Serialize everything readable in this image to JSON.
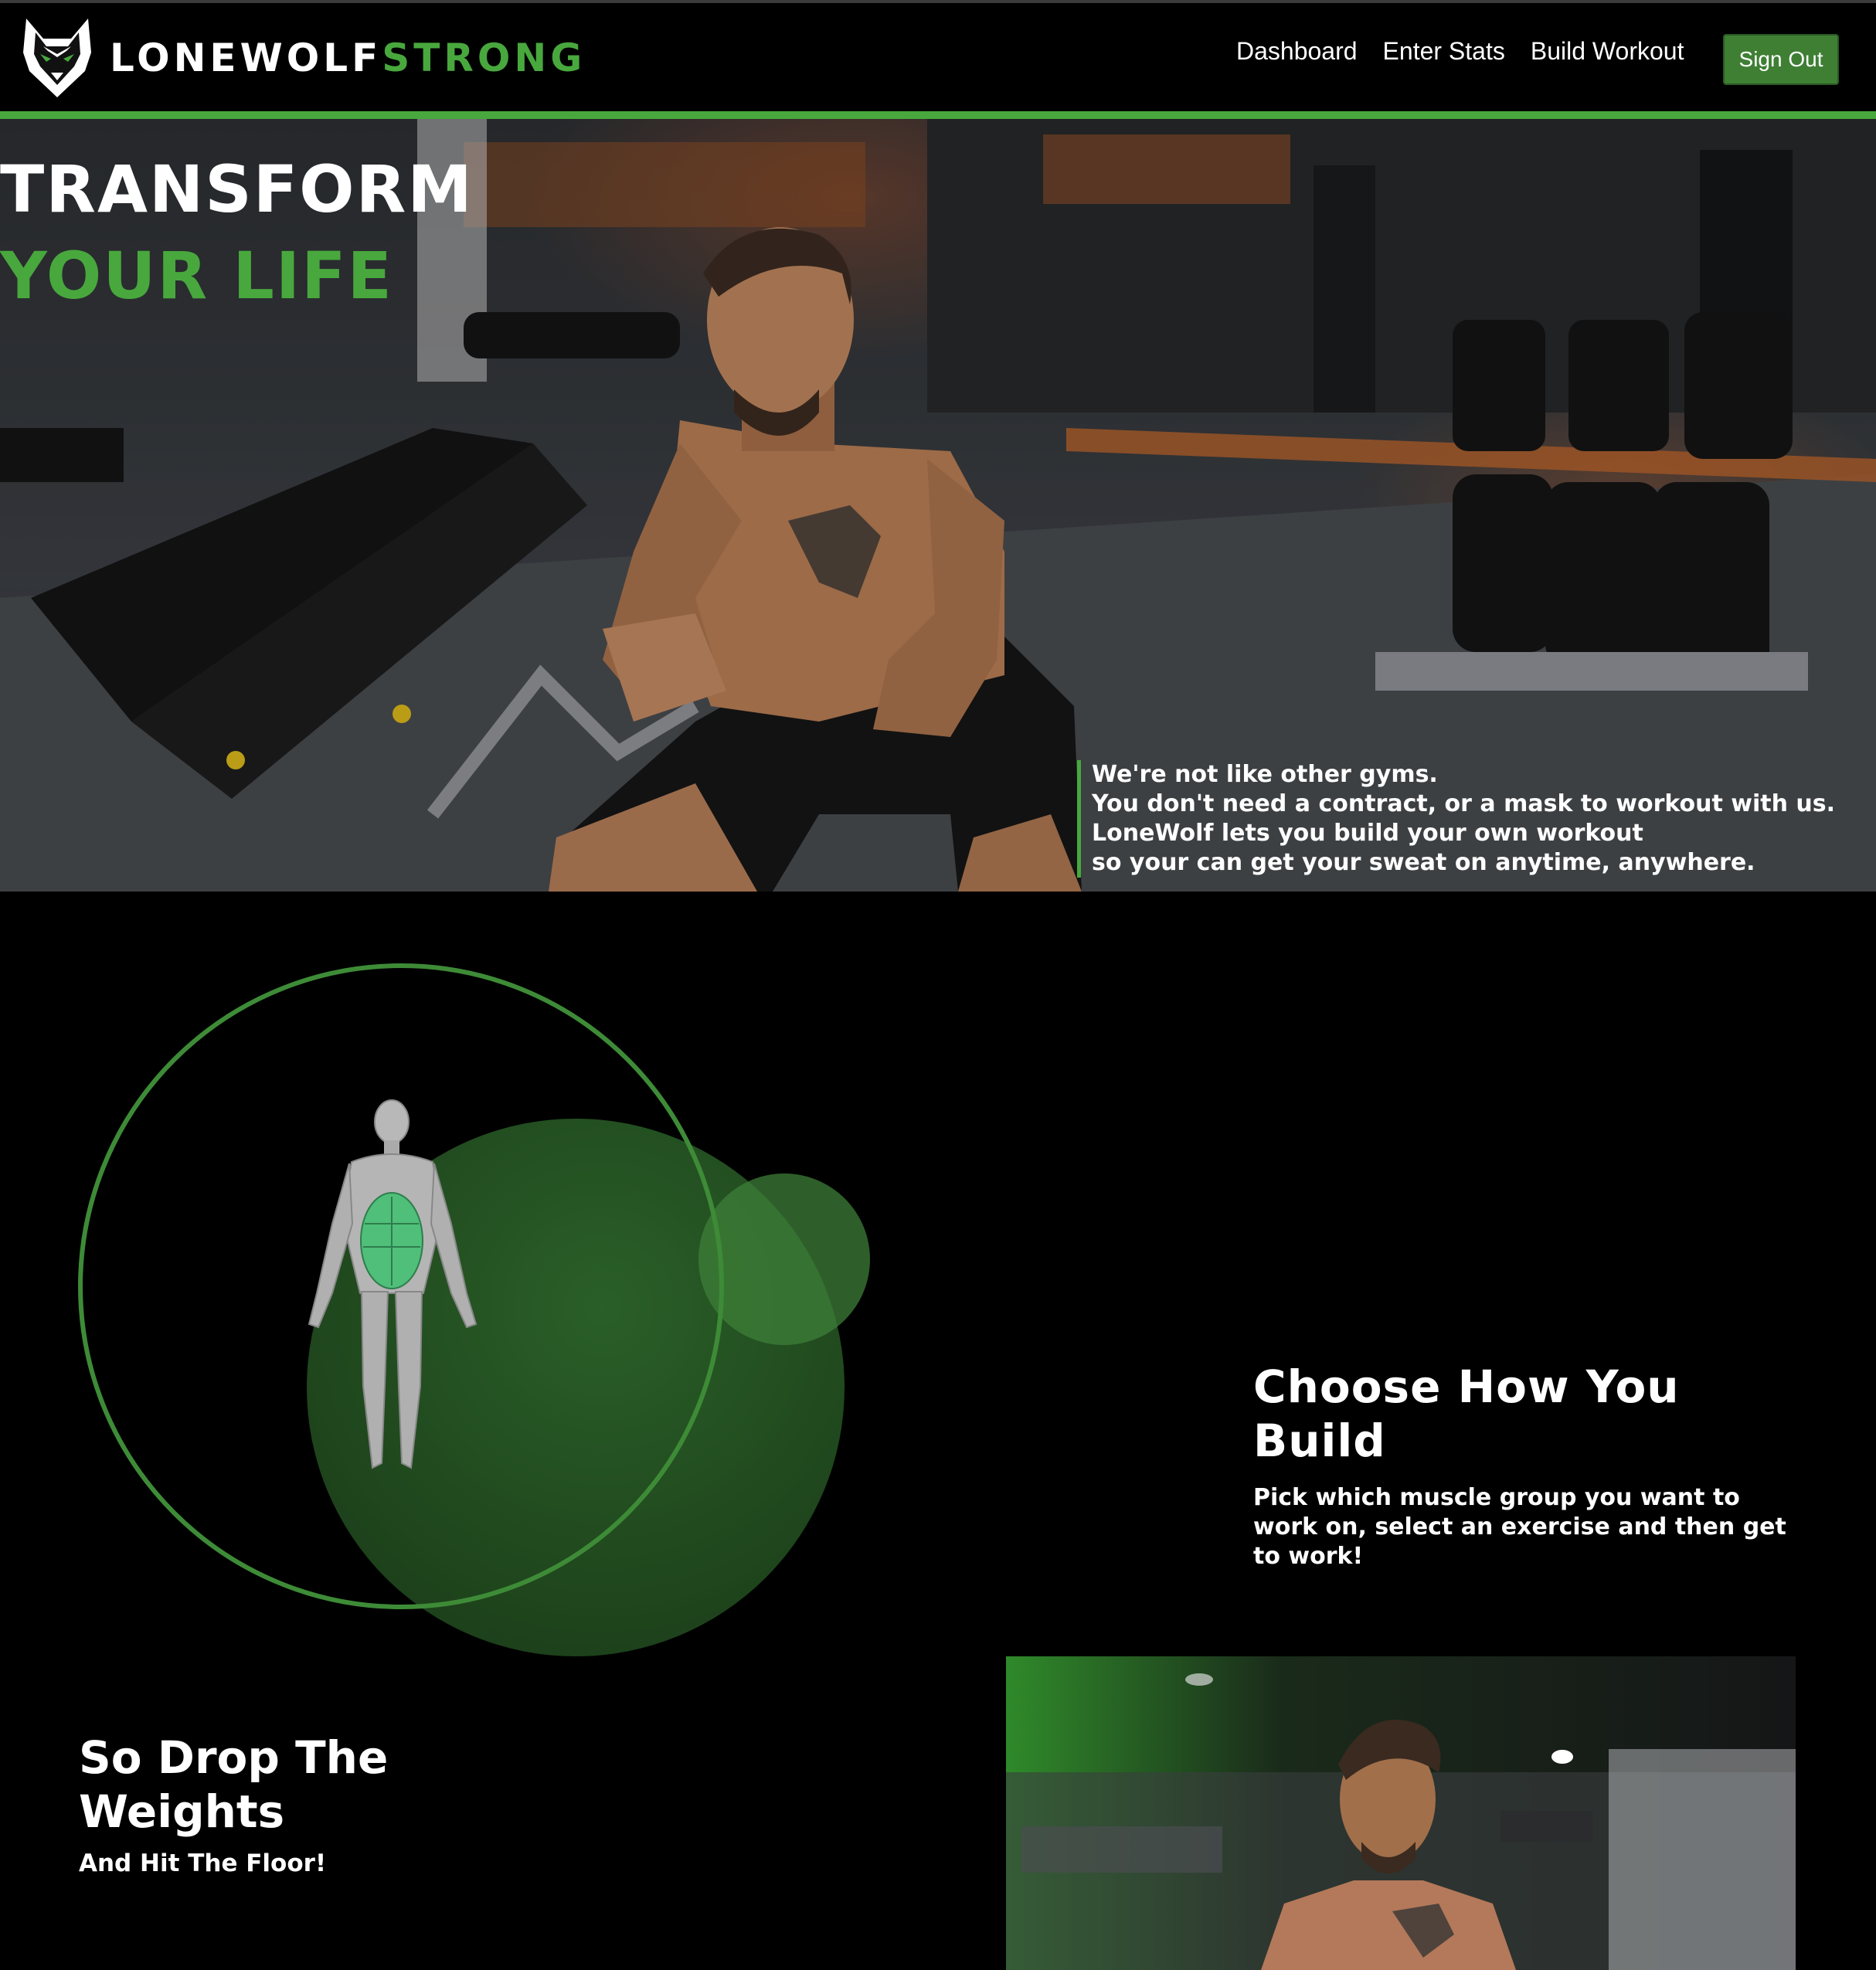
{
  "brand": {
    "name_white": "LONEWOLF",
    "name_green": "STRONG",
    "logo": "wolf-head-logo"
  },
  "nav": {
    "links": [
      {
        "label": "Dashboard"
      },
      {
        "label": "Enter Stats"
      },
      {
        "label": "Build Workout"
      }
    ],
    "signout_label": "Sign Out"
  },
  "hero": {
    "title_line1": "TRANSFORM",
    "title_line2": "YOUR LIFE",
    "quote": [
      "We're not like other gyms.",
      "You don't need a contract, or a mask to workout with us.",
      "LoneWolf lets you build your own workout",
      "so your can get your sweat on anytime, anywhere."
    ],
    "image": "man-squatting-in-gym-photo"
  },
  "choose": {
    "title": "Choose How You Build",
    "text": "Pick which muscle group you want to work on, select an exercise and then get to work!",
    "figure": "anatomy-figure-abs-highlighted"
  },
  "drop": {
    "title": "So Drop The Weights",
    "subtitle": "And Hit The Floor!",
    "image": "man-portrait-in-gym-photo"
  },
  "colors": {
    "accent": "#48a83d",
    "button": "#3e7f34",
    "background": "#000000",
    "text": "#ffffff"
  }
}
